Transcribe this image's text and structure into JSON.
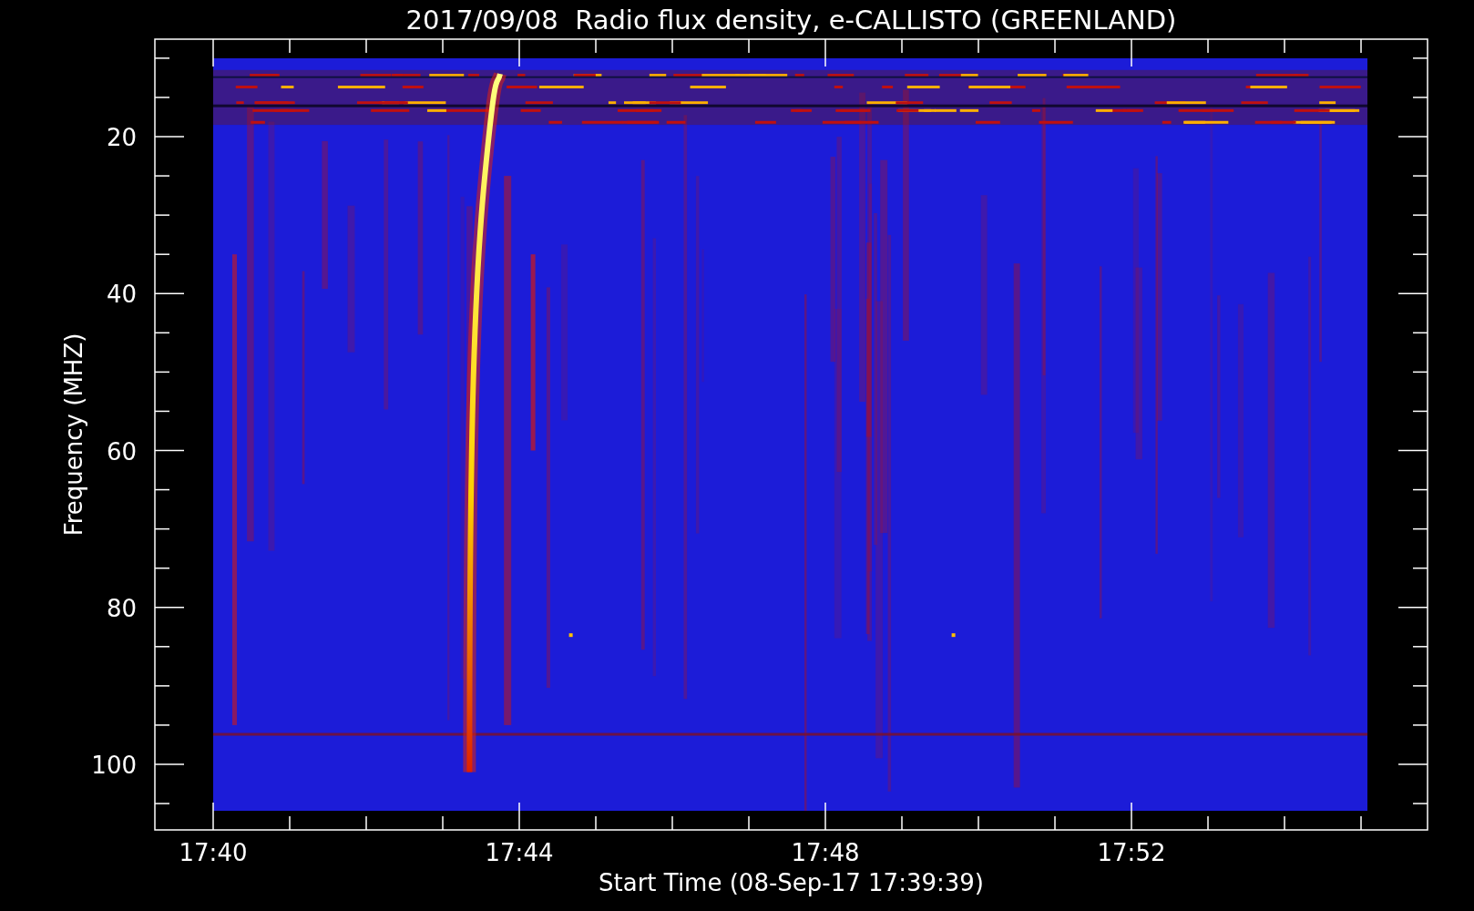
{
  "plot": {
    "title": "2017/09/08  Radio flux density, e-CALLISTO (GREENLAND)",
    "ylabel": "Frequency (MHZ)",
    "xlabel": "Start Time (08-Sep-17 17:39:39)",
    "yticks": [
      "20",
      "40",
      "60",
      "80",
      "100"
    ],
    "xticks": [
      "17:40",
      "17:44",
      "17:48",
      "17:52"
    ]
  }
}
